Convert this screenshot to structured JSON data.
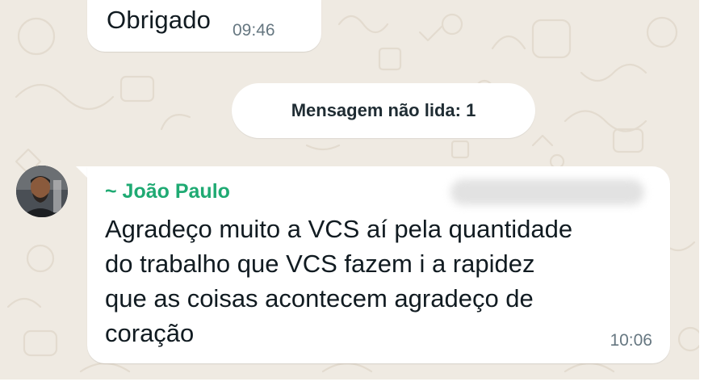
{
  "conversation": {
    "outgoing_top": {
      "text": "Obrigado",
      "time": "09:46"
    },
    "unread_divider": {
      "label": "Mensagem não lida: 1"
    },
    "incoming": {
      "sender": "~ João Paulo",
      "text": "Agradeço muito a VCS aí pela quantidade\ndo trabalho que VCS fazem i a rapidez\nque as coisas acontecem agradeço de\ncoração",
      "time": "10:06"
    }
  },
  "colors": {
    "wallpaper": "#efeae2",
    "bubble": "#ffffff",
    "sender_name": "#1faa73",
    "timestamp": "#667781",
    "text": "#111b21"
  }
}
